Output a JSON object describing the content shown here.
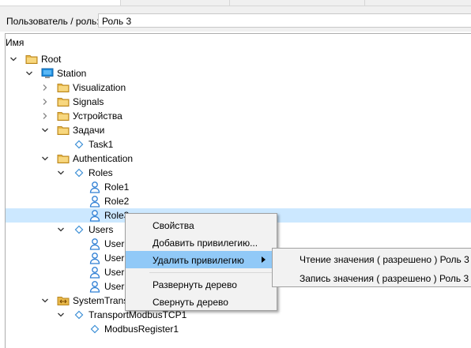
{
  "toolbar": {
    "user_role_label": "Пользователь / роль:",
    "role_value": "Роль 3"
  },
  "tree": {
    "column_header": "Имя",
    "nodes": [
      {
        "label": "Root",
        "expander": "expanded",
        "icon": "folder-icon"
      },
      {
        "label": "Station",
        "expander": "expanded",
        "icon": "monitor-icon"
      },
      {
        "label": "Visualization",
        "expander": "collapsed",
        "icon": "folder-icon"
      },
      {
        "label": "Signals",
        "expander": "collapsed",
        "icon": "folder-icon"
      },
      {
        "label": "Устройства",
        "expander": "collapsed",
        "icon": "folder-icon"
      },
      {
        "label": "Задачи",
        "expander": "expanded",
        "icon": "folder-icon"
      },
      {
        "label": "Task1",
        "expander": "none",
        "icon": "diamond-icon"
      },
      {
        "label": "Authentication",
        "expander": "expanded",
        "icon": "folder-icon"
      },
      {
        "label": "Roles",
        "expander": "expanded",
        "icon": "diamond-icon"
      },
      {
        "label": "Role1",
        "expander": "none",
        "icon": "user-icon"
      },
      {
        "label": "Role2",
        "expander": "none",
        "icon": "user-icon"
      },
      {
        "label": "Role3",
        "expander": "none",
        "icon": "user-icon",
        "selected": true
      },
      {
        "label": "Users",
        "expander": "expanded",
        "icon": "diamond-icon"
      },
      {
        "label": "User",
        "expander": "none",
        "icon": "user-icon"
      },
      {
        "label": "User",
        "expander": "none",
        "icon": "user-icon"
      },
      {
        "label": "User",
        "expander": "none",
        "icon": "user-icon"
      },
      {
        "label": "User",
        "expander": "none",
        "icon": "user-icon"
      },
      {
        "label": "SystemTrans",
        "expander": "expanded",
        "icon": "transport-icon"
      },
      {
        "label": "TransportModbusTCP1",
        "expander": "expanded",
        "icon": "diamond-icon"
      },
      {
        "label": "ModbusRegister1",
        "expander": "none",
        "icon": "diamond-icon"
      }
    ]
  },
  "context_menu": {
    "items": [
      {
        "label": "Свойства"
      },
      {
        "label": "Добавить привилегию..."
      },
      {
        "label": "Удалить привилегию",
        "has_submenu": true,
        "highlighted": true
      },
      {
        "label": "Развернуть дерево"
      },
      {
        "label": "Свернуть дерево"
      }
    ],
    "submenu": [
      {
        "label": "Чтение значения ( разрешено ) Роль 3"
      },
      {
        "label": "Запись значения ( разрешено ) Роль 3"
      }
    ]
  },
  "colors": {
    "selection": "#cce8ff",
    "menu_highlight": "#91c9f7",
    "folder": "#e8b84a",
    "diamond": "#3c8fd6",
    "user": "#2f7fd4"
  }
}
